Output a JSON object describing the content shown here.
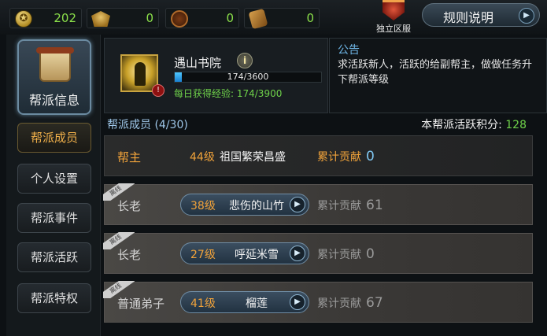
{
  "resources": [
    {
      "icon": "gold-coin-icon",
      "value": "202"
    },
    {
      "icon": "winged-badge-icon",
      "value": "0"
    },
    {
      "icon": "round-emblem-icon",
      "value": "0"
    },
    {
      "icon": "token-icon",
      "value": "0"
    }
  ],
  "server_tag": "独立区服",
  "rules_button": "规则说明",
  "nav": {
    "main": "帮派信息",
    "items": [
      "帮派成员",
      "个人设置",
      "帮派事件",
      "帮派活跃",
      "帮派特权"
    ]
  },
  "guild": {
    "name": "遇山书院",
    "exp_text": "174/3600",
    "exp_fraction": 0.048,
    "daily_exp": "每日获得经验: 174/3900",
    "alert": "!"
  },
  "notice": {
    "title": "公告",
    "body": "求活跃新人，活跃的给副帮主，做做任务升下帮派等级"
  },
  "members_header": {
    "count": "帮派成员 (4/30)",
    "score_label": "本帮派活跃积分:",
    "score_value": "128"
  },
  "members": [
    {
      "role": "帮主",
      "level": "44级",
      "name": "祖国繁荣昌盛",
      "contrib_label": "累计贡献",
      "contrib": "0",
      "ribbon": ""
    },
    {
      "role": "长老",
      "level": "38级",
      "name": "悲伤的山竹",
      "contrib_label": "累计贡献",
      "contrib": "61",
      "ribbon": "离线"
    },
    {
      "role": "长老",
      "level": "27级",
      "name": "呼延米雪",
      "contrib_label": "累计贡献",
      "contrib": "0",
      "ribbon": "离线"
    },
    {
      "role": "普通弟子",
      "level": "41级",
      "name": "榴莲",
      "contrib_label": "累计贡献",
      "contrib": "67",
      "ribbon": "离线"
    }
  ],
  "colors": {
    "accent_orange": "#f0a23a",
    "accent_green": "#6fd24a",
    "accent_blue": "#6fb6e6"
  }
}
